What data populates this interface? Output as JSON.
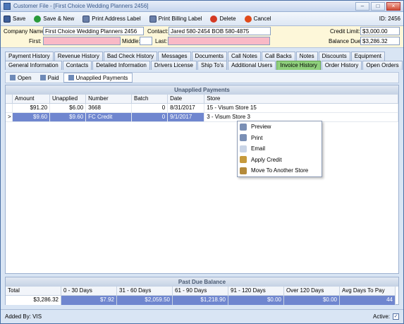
{
  "window": {
    "title": "Customer File - [First Choice Wedding Planners 2456]",
    "controls": [
      "–",
      "□",
      "×"
    ]
  },
  "toolbar": {
    "save": "Save",
    "save_new": "Save & New",
    "print_address": "Print Address Label",
    "print_billing": "Print Billing Label",
    "delete": "Delete",
    "cancel": "Cancel",
    "id_text": "ID: 2456"
  },
  "header": {
    "company_label": "Company Name:",
    "company_value": "First Choice Wedding Planners 2456",
    "contact_label": "Contact:",
    "contact_value": "Jared 580-2454 BOB  580-4875",
    "first_label": "First:",
    "middle_label": "Middle:",
    "last_label": "Last:",
    "credit_limit_label": "Credit Limit:",
    "credit_limit_value": "$3,000.00",
    "balance_due_label": "Balance Due:",
    "balance_due_value": "$3,286.32"
  },
  "tabs": {
    "row1": [
      "Payment History",
      "Revenue History",
      "Bad Check History",
      "Messages",
      "Documents",
      "Call Notes",
      "Call Backs",
      "Notes",
      "Discounts",
      "Equipment"
    ],
    "row2": [
      "General Information",
      "Contacts",
      "Detailed Information",
      "Drivers License",
      "Ship To's",
      "Additional Users",
      "Invoice History",
      "Order History",
      "Open Orders",
      "Credit History"
    ],
    "active": "Invoice History"
  },
  "subtabs": [
    "Open",
    "Paid",
    "Unapplied Payments"
  ],
  "grid": {
    "title": "Unapplied Payments",
    "columns": [
      "Amount",
      "Unapplied",
      "Number",
      "Batch",
      "Date",
      "Store"
    ],
    "rows": [
      {
        "indicator": "",
        "amount": "$91.20",
        "unapplied": "$6.00",
        "number": "3668",
        "batch": "0",
        "date": "8/31/2017",
        "store": "15 - Visum Store 15"
      },
      {
        "indicator": ">",
        "amount": "$9.60",
        "unapplied": "$9.60",
        "number": "FC Credit",
        "batch": "0",
        "date": "9/1/2017",
        "store": "3 - Visum Store 3"
      }
    ]
  },
  "context_menu": [
    "Preview",
    "Print",
    "Email",
    "Apply Credit",
    "Move  To Another Store"
  ],
  "past_due": {
    "title": "Past Due Balance",
    "columns": [
      "Total",
      "0 - 30 Days",
      "31 - 60 Days",
      "61 - 90 Days",
      "91 - 120 Days",
      "Over 120 Days",
      "Avg Days To Pay"
    ],
    "values": [
      "$3,286.32",
      "$7.92",
      "$2,059.50",
      "$1,218.90",
      "$0.00",
      "$0.00",
      "44"
    ]
  },
  "status": {
    "added_by": "Added By: VIS",
    "active_label": "Active:",
    "active_checked": "✓"
  }
}
